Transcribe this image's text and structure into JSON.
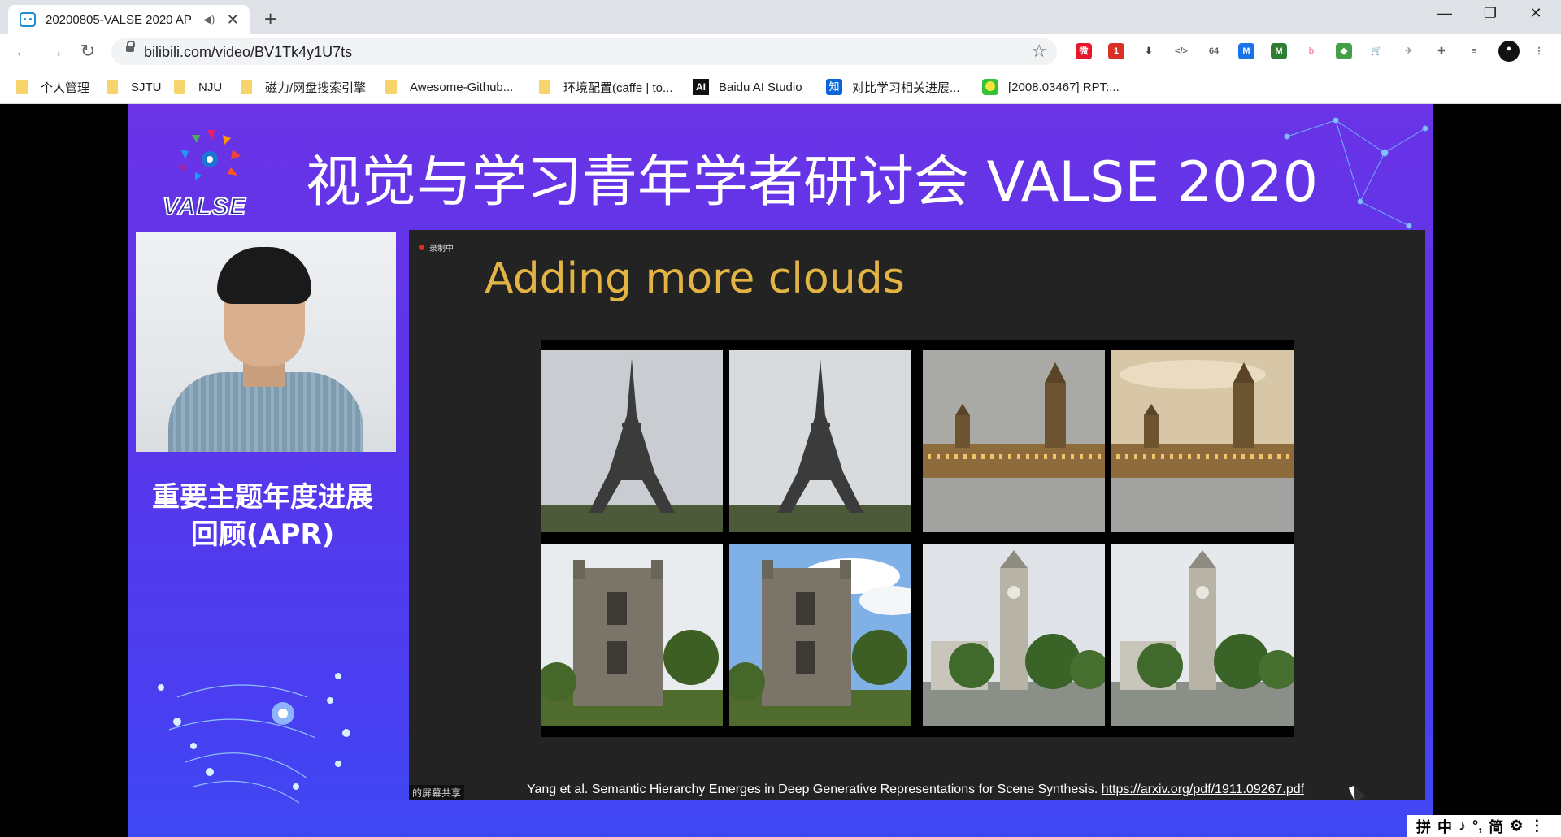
{
  "browser": {
    "tab": {
      "title": "20200805-VALSE 2020 AP",
      "audio_icon": "speaker-icon",
      "close_glyph": "✕"
    },
    "new_tab_glyph": "+",
    "window_controls": {
      "minimize": "—",
      "restore": "❐",
      "close": "✕"
    },
    "nav": {
      "back": "←",
      "forward": "→",
      "reload": "↻"
    },
    "address": {
      "url": "bilibili.com/video/BV1Tk4y1U7ts",
      "bookmark_star": "☆"
    },
    "extensions": [
      {
        "name": "weibo-ext-icon",
        "color": "#e6162d",
        "glyph": "微"
      },
      {
        "name": "notification-ext-icon",
        "color": "#d93025",
        "glyph": "1"
      },
      {
        "name": "download-ext-icon",
        "color": "#3c4043",
        "glyph": "⬇"
      },
      {
        "name": "code-ext-icon",
        "color": "#5f6368",
        "glyph": "</>"
      },
      {
        "name": "base64-ext-icon",
        "color": "#5f6368",
        "glyph": "64"
      },
      {
        "name": "m-blue-ext-icon",
        "color": "#1a73e8",
        "glyph": "M"
      },
      {
        "name": "m-green-ext-icon",
        "color": "#2e7d32",
        "glyph": "M"
      },
      {
        "name": "bilibili-ext-icon",
        "color": "#f48fb1",
        "glyph": "b"
      },
      {
        "name": "colorful-ext-icon",
        "color": "#43a047",
        "glyph": "◆"
      },
      {
        "name": "cart-ext-icon",
        "color": "#d93025",
        "glyph": "🛒"
      },
      {
        "name": "bird-ext-icon",
        "color": "#9aa0a6",
        "glyph": "✈"
      },
      {
        "name": "puzzle-ext-icon",
        "color": "#5f6368",
        "glyph": "✚"
      },
      {
        "name": "playlist-ext-icon",
        "color": "#5f6368",
        "glyph": "≡"
      },
      {
        "name": "profile-avatar",
        "color": "#111111",
        "glyph": "●"
      },
      {
        "name": "menu-kebab-icon",
        "color": "#5f6368",
        "glyph": "⋮"
      }
    ]
  },
  "bookmarks": [
    {
      "label": "个人管理",
      "icon": "folder"
    },
    {
      "label": "SJTU",
      "icon": "folder"
    },
    {
      "label": "NJU",
      "icon": "folder"
    },
    {
      "label": "磁力/网盘搜索引擎",
      "icon": "folder"
    },
    {
      "label": "Awesome-Github...",
      "icon": "folder"
    },
    {
      "label": "环境配置(caffe | to...",
      "icon": "folder"
    },
    {
      "label": "Baidu AI Studio",
      "icon": "ai"
    },
    {
      "label": "对比学习相关进展...",
      "icon": "zhihu"
    },
    {
      "label": "[2008.03467] RPT:...",
      "icon": "smile"
    }
  ],
  "slide": {
    "logo_text": "VALSE",
    "banner": "视觉与学习青年学者研讨会 VALSE 2020",
    "topic_line1": "重要主题年度进展",
    "topic_line2": "回顾(APR)",
    "recording_label": "录制中",
    "heading": "Adding more clouds",
    "share_label": "的屏幕共享",
    "citation": "Yang et al. Semantic Hierarchy Emerges in Deep Generative Representations for Scene Synthesis.",
    "citation_link": "https://arxiv.org/pdf/1911.09267.pdf",
    "photos": [
      {
        "name": "eiffel-tower-original",
        "scene": "eiffel",
        "sky": "#c9cdd1"
      },
      {
        "name": "eiffel-tower-clouds",
        "scene": "eiffel",
        "sky": "#d8dbde"
      },
      {
        "name": "parliament-original",
        "scene": "parliament",
        "sky": "#a9a9a6"
      },
      {
        "name": "parliament-clouds",
        "scene": "parliament",
        "sky": "#d7c7a6"
      },
      {
        "name": "gothic-tower-original",
        "scene": "gothic",
        "sky": "#e9ecef"
      },
      {
        "name": "gothic-tower-clouds",
        "scene": "gothic",
        "sky": "#7fb0e6"
      },
      {
        "name": "clock-tower-original",
        "scene": "clock",
        "sky": "#dfe3e7"
      },
      {
        "name": "clock-tower-clouds",
        "scene": "clock",
        "sky": "#e6e9ec"
      }
    ]
  },
  "ime": [
    "拼",
    "中",
    "♪",
    "°,",
    "简",
    "⚙",
    "⋮"
  ]
}
